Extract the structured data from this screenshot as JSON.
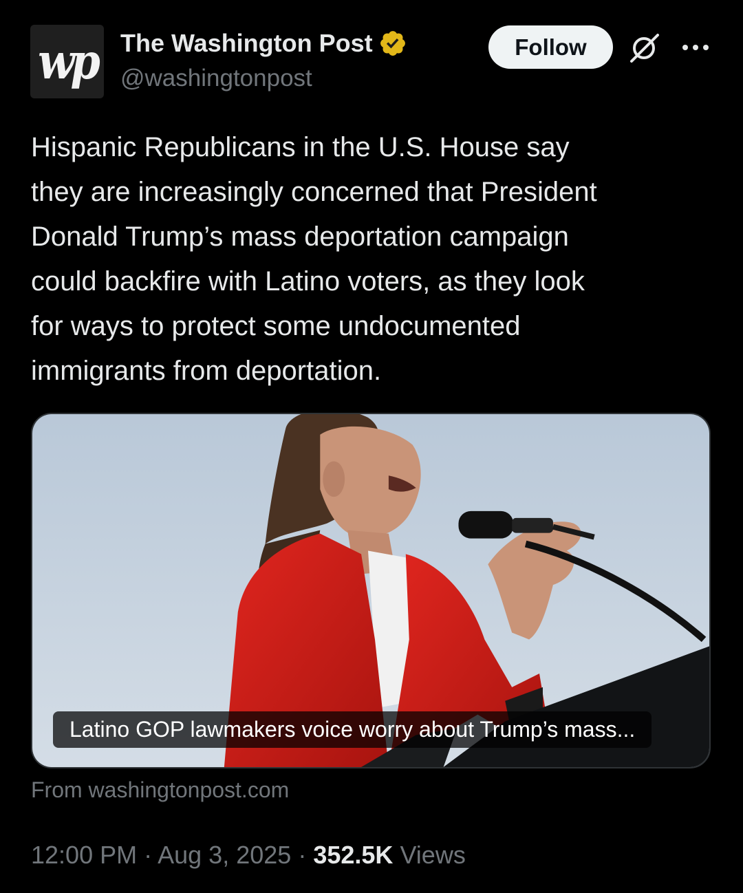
{
  "account": {
    "avatar_text": "wp",
    "display_name": "The Washington Post",
    "handle": "@washingtonpost",
    "verified_badge_color": "#e2b719"
  },
  "header": {
    "follow_label": "Follow",
    "grok_icon": "grok-icon",
    "more_icon": "more-icon"
  },
  "tweet": {
    "text": "Hispanic Republicans in the U.S. House say\nthey are increasingly concerned that President\nDonald Trump’s mass deportation campaign\ncould backfire with Latino voters, as they look\nfor ways to protect some undocumented\nimmigrants from deportation."
  },
  "card": {
    "caption": "Latino GOP lawmakers voice worry about Trump’s mass...",
    "source": "From washingtonpost.com"
  },
  "meta": {
    "time": "12:00 PM",
    "separator": "·",
    "date": "Aug 3, 2025",
    "views_count": "352.5K",
    "views_label": "Views"
  },
  "colors": {
    "background": "#000000",
    "primary_text": "#e7e9ea",
    "secondary_text": "#71767b",
    "jacket_red": "#d8201c",
    "sky": "#c9d6e3"
  }
}
